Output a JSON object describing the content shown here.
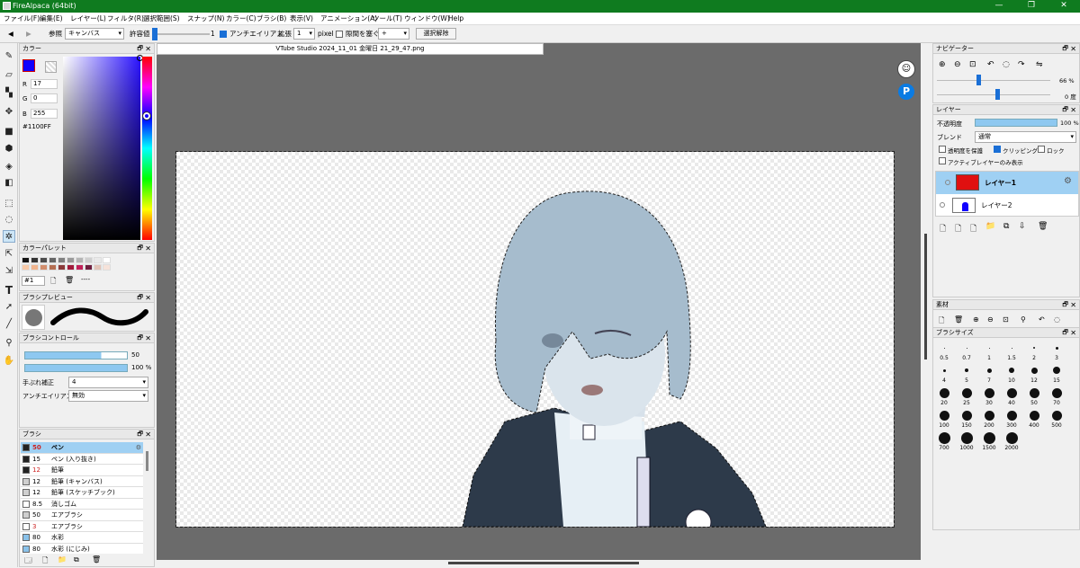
{
  "window": {
    "title": "FireAlpaca (64bit)",
    "minimize": "—",
    "maximize": "❐",
    "close": "✕"
  },
  "menu": [
    "ファイル(F)",
    "編集(E)",
    "レイヤー(L)",
    "フィルタ(R)",
    "選択範囲(S)",
    "スナップ(N)",
    "カラー(C)",
    "ブラシ(B)",
    "表示(V)",
    "アニメーション(A)",
    "ツール(T)",
    "ウィンドウ(W)",
    "Help"
  ],
  "toolbar": {
    "prev": "◀",
    "next": "▶",
    "ref_label": "参照",
    "ref_value": "キャンバス",
    "tolerance_label": "許容値",
    "tolerance_value": "1",
    "antialias_label": "アンチエイリアス",
    "expand_label": "拡張",
    "expand_value": "1",
    "expand_unit": "pixel",
    "gap_label": "隙間を塞ぐ",
    "gap_value": "+",
    "deselect_label": "選択解除"
  },
  "color_panel": {
    "title": "カラー",
    "r_label": "R",
    "r_value": "17",
    "g_label": "G",
    "g_value": "0",
    "b_label": "B",
    "b_value": "255",
    "hex": "#1100FF",
    "foreground": "#1100ff"
  },
  "palette_panel": {
    "title": "カラーパレット",
    "selected": "#1",
    "dash": "----",
    "colors": [
      "#111111",
      "#333333",
      "#4b4b4b",
      "#656565",
      "#808080",
      "#9a9a9a",
      "#b5b5b5",
      "#cfcfcf",
      "#e9e9e9",
      "#ffffff",
      "#f7c9a8",
      "#f0b48e",
      "#d28e6d",
      "#b46e52",
      "#8b3a3a",
      "#a11a3b",
      "#c2215a",
      "#6f1f3f",
      "#e2c4b8",
      "#f6e3da"
    ]
  },
  "brush_preview": {
    "title": "ブラシプレビュー"
  },
  "brush_control": {
    "title": "ブラシコントロール",
    "size_value": "50",
    "opacity_value": "100 %",
    "stabilizer_label": "手ぶれ補正",
    "stabilizer_value": "4",
    "antialias_label": "アンチエイリアス",
    "antialias_value": "無効"
  },
  "brush_panel": {
    "title": "ブラシ",
    "items": [
      {
        "size": "50",
        "name": "ペン",
        "color": "#222222",
        "selected": true
      },
      {
        "size": "15",
        "name": "ペン (入り抜き)",
        "color": "#222222"
      },
      {
        "size": "12",
        "name": "鉛筆",
        "color": "#222222"
      },
      {
        "size": "12",
        "name": "鉛筆 (キャンバス)",
        "color": "#cfcfcf"
      },
      {
        "size": "12",
        "name": "鉛筆 (スケッチブック)",
        "color": "#cfcfcf"
      },
      {
        "size": "8.5",
        "name": "消しゴム",
        "color": "#ffffff"
      },
      {
        "size": "50",
        "name": "エアブラシ",
        "color": "#cfcfcf"
      },
      {
        "size": "3",
        "name": "エアブラシ",
        "color": "#ffffff"
      },
      {
        "size": "80",
        "name": "水彩",
        "color": "#8ac2ea"
      },
      {
        "size": "80",
        "name": "水彩 (にじみ)",
        "color": "#8ac2ea"
      }
    ]
  },
  "document": {
    "tab_title": "VTube Studio 2024_11_01 金曜日 21_29_47.png"
  },
  "navigator": {
    "title": "ナビゲーター",
    "zoom": "66 %",
    "rotation": "0 度"
  },
  "layer_panel": {
    "title": "レイヤー",
    "opacity_label": "不透明度",
    "opacity_value": "100 %",
    "blend_label": "ブレンド",
    "blend_value": "通常",
    "protect_label": "透明度を保護",
    "clipping_label": "クリッピング",
    "lock_label": "ロック",
    "active_only_label": "アクティブレイヤーのみ表示",
    "layers": [
      {
        "name": "レイヤー1",
        "active": true
      },
      {
        "name": "レイヤー2",
        "active": false
      }
    ]
  },
  "material_panel": {
    "title": "素材"
  },
  "brush_size_panel": {
    "title": "ブラシサイズ",
    "sizes": [
      "0.5",
      "0.7",
      "1",
      "1.5",
      "2",
      "3",
      "4",
      "5",
      "7",
      "10",
      "12",
      "15",
      "20",
      "25",
      "30",
      "40",
      "50",
      "70",
      "100",
      "150",
      "200",
      "300",
      "400",
      "500",
      "700",
      "1000",
      "1500",
      "2000"
    ]
  }
}
